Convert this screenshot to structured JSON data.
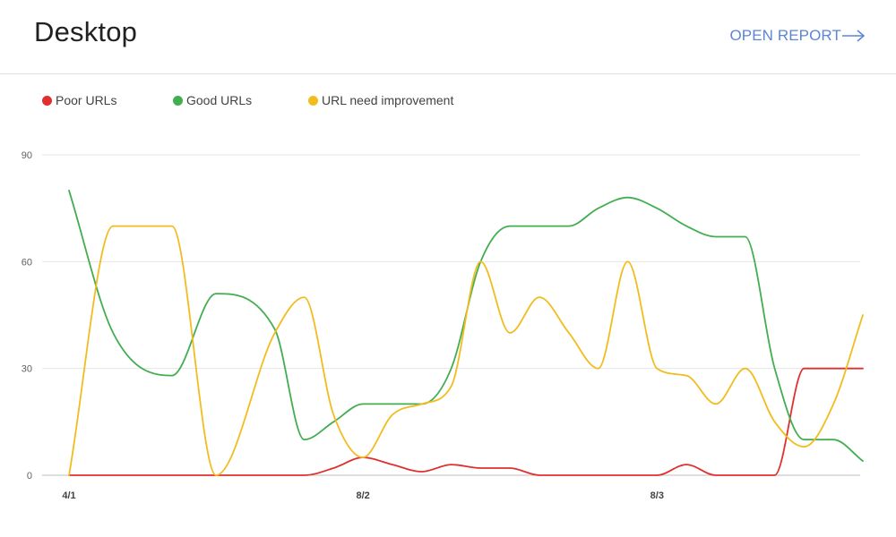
{
  "header": {
    "title": "Desktop",
    "open_report_label": "OPEN REPORT",
    "open_report_icon": "arrow-right-icon"
  },
  "colors": {
    "poor": "#e02f2f",
    "good": "#43ad51",
    "improve": "#f2bc1f",
    "link": "#5c85d6",
    "grid": "#e6e6e6",
    "axis": "#bdbdbd"
  },
  "chart_data": {
    "type": "line",
    "title": "",
    "xlabel": "",
    "ylabel": "",
    "ylim": [
      0,
      90
    ],
    "yticks": [
      0,
      30,
      60,
      90
    ],
    "xlim": [
      0,
      27
    ],
    "xticks": [
      {
        "x": 0,
        "label": "4/1"
      },
      {
        "x": 10,
        "label": "8/2"
      },
      {
        "x": 20,
        "label": "8/3"
      }
    ],
    "grid": true,
    "legend_placement": "top-left",
    "x": [
      0,
      1.5,
      3.5,
      5,
      7,
      8,
      9,
      10,
      11,
      12,
      13,
      14,
      15,
      16,
      17,
      18,
      19,
      20,
      21,
      22,
      23,
      24,
      25,
      26,
      27
    ],
    "series": [
      {
        "name": "Poor URLs",
        "color_key": "poor",
        "values": [
          0,
          0,
          0,
          0,
          0,
          0,
          2,
          5,
          3,
          1,
          3,
          2,
          2,
          0,
          0,
          0,
          0,
          0,
          3,
          0,
          0,
          0,
          30,
          30,
          30
        ]
      },
      {
        "name": "Good URLs",
        "color_key": "good",
        "values": [
          80,
          40,
          28,
          51,
          41,
          10,
          15,
          20,
          20,
          20,
          30,
          60,
          70,
          70,
          70,
          75,
          78,
          75,
          70,
          67,
          67,
          30,
          10,
          10,
          4
        ]
      },
      {
        "name": "URL need improvement",
        "color_key": "improve",
        "values": [
          0,
          70,
          70,
          0,
          40,
          50,
          17,
          5,
          17,
          20,
          25,
          60,
          40,
          50,
          40,
          30,
          60,
          30,
          28,
          20,
          30,
          15,
          8,
          20,
          45
        ]
      }
    ]
  }
}
